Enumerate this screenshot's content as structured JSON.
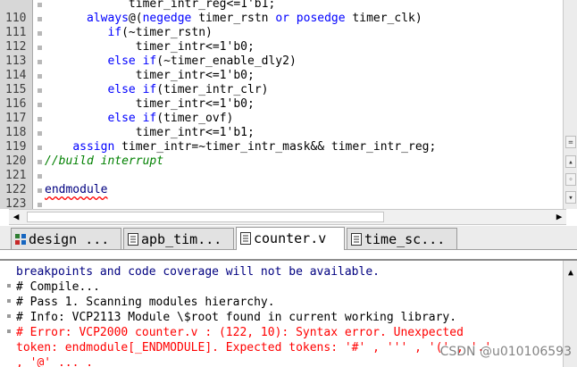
{
  "editor": {
    "line_numbers": [
      "",
      "110",
      "111",
      "112",
      "113",
      "114",
      "115",
      "116",
      "117",
      "118",
      "119",
      "120",
      "121",
      "122",
      "123"
    ],
    "lines": [
      {
        "segments": [
          {
            "text": "            timer_intr_reg<=1'b1;",
            "cls": ""
          }
        ]
      },
      {
        "segments": [
          {
            "text": "      ",
            "cls": ""
          },
          {
            "text": "always",
            "cls": "kw"
          },
          {
            "text": "@(",
            "cls": ""
          },
          {
            "text": "negedge",
            "cls": "kw"
          },
          {
            "text": " timer_rstn ",
            "cls": ""
          },
          {
            "text": "or",
            "cls": "kw"
          },
          {
            "text": " ",
            "cls": ""
          },
          {
            "text": "posedge",
            "cls": "kw"
          },
          {
            "text": " timer_clk)",
            "cls": ""
          }
        ]
      },
      {
        "segments": [
          {
            "text": "         ",
            "cls": ""
          },
          {
            "text": "if",
            "cls": "kw"
          },
          {
            "text": "(~timer_rstn)",
            "cls": ""
          }
        ]
      },
      {
        "segments": [
          {
            "text": "             timer_intr<=1'b0;",
            "cls": ""
          }
        ]
      },
      {
        "segments": [
          {
            "text": "         ",
            "cls": ""
          },
          {
            "text": "else",
            "cls": "kw"
          },
          {
            "text": " ",
            "cls": ""
          },
          {
            "text": "if",
            "cls": "kw"
          },
          {
            "text": "(~timer_enable_dly2)",
            "cls": ""
          }
        ]
      },
      {
        "segments": [
          {
            "text": "             timer_intr<=1'b0;",
            "cls": ""
          }
        ]
      },
      {
        "segments": [
          {
            "text": "         ",
            "cls": ""
          },
          {
            "text": "else",
            "cls": "kw"
          },
          {
            "text": " ",
            "cls": ""
          },
          {
            "text": "if",
            "cls": "kw"
          },
          {
            "text": "(timer_intr_clr)",
            "cls": ""
          }
        ]
      },
      {
        "segments": [
          {
            "text": "             timer_intr<=1'b0;",
            "cls": ""
          }
        ]
      },
      {
        "segments": [
          {
            "text": "         ",
            "cls": ""
          },
          {
            "text": "else",
            "cls": "kw"
          },
          {
            "text": " ",
            "cls": ""
          },
          {
            "text": "if",
            "cls": "kw"
          },
          {
            "text": "(timer_ovf)",
            "cls": ""
          }
        ]
      },
      {
        "segments": [
          {
            "text": "             timer_intr<=1'b1;",
            "cls": ""
          }
        ]
      },
      {
        "segments": [
          {
            "text": "    ",
            "cls": ""
          },
          {
            "text": "assign",
            "cls": "kw"
          },
          {
            "text": " timer_intr=~timer_intr_mask&& timer_intr_reg;",
            "cls": ""
          }
        ]
      },
      {
        "segments": [
          {
            "text": "//build interrupt",
            "cls": "cm"
          }
        ]
      },
      {
        "segments": [
          {
            "text": "",
            "cls": ""
          }
        ]
      },
      {
        "segments": [
          {
            "text": "endmodule",
            "cls": "err"
          }
        ]
      },
      {
        "segments": [
          {
            "text": "",
            "cls": ""
          }
        ]
      }
    ]
  },
  "tabs": [
    {
      "label": "design ...",
      "icon": "design-icon",
      "active": false
    },
    {
      "label": "apb_tim...",
      "icon": "file-icon",
      "active": false
    },
    {
      "label": "counter.v",
      "icon": "file-icon",
      "active": true
    },
    {
      "label": "time_sc...",
      "icon": "file-icon",
      "active": false
    }
  ],
  "console": {
    "lines": [
      {
        "text": "breakpoints and code coverage will not be available.",
        "color": "blue",
        "dot": false
      },
      {
        "text": "# Compile...",
        "color": "black",
        "dot": true
      },
      {
        "text": "# Pass 1. Scanning modules hierarchy.",
        "color": "black",
        "dot": true
      },
      {
        "text": "# Info: VCP2113 Module \\$root found in current working library.",
        "color": "black",
        "dot": true
      },
      {
        "text": "# Error: VCP2000 counter.v : (122, 10): Syntax error. Unexpected",
        "color": "red",
        "dot": true
      },
      {
        "text": "token: endmodule[_ENDMODULE]. Expected tokens: '#' , ''' , '(' , '.'",
        "color": "red",
        "dot": false
      },
      {
        "text": ", '@' ... .",
        "color": "red",
        "dot": false
      }
    ]
  },
  "watermark": "CSDN @u010106593",
  "colors": {
    "keyword": "#0000ff",
    "comment": "#008000",
    "error_text": "#ff0000",
    "info_text": "#000080",
    "gutter_bg": "#d7d7d7"
  }
}
